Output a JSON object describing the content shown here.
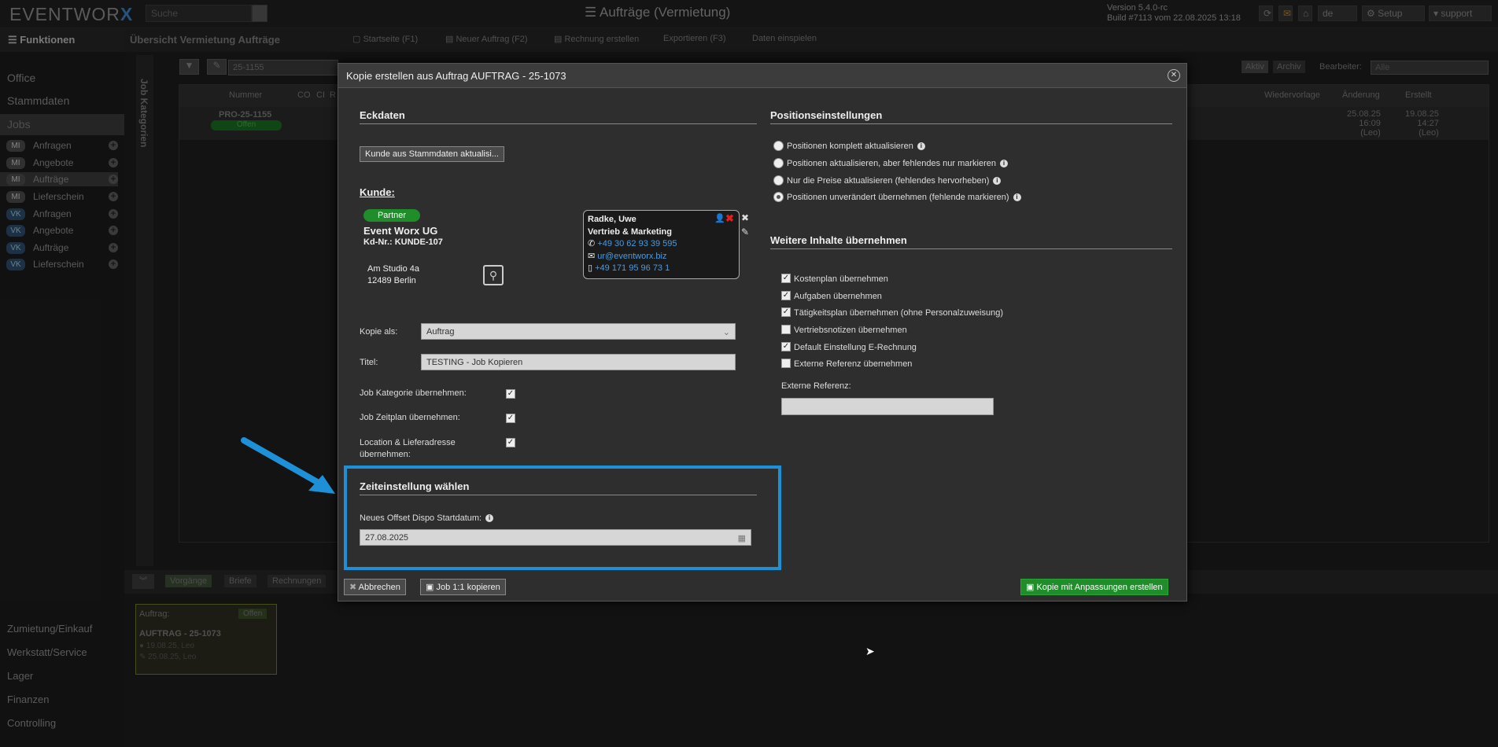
{
  "app": {
    "logo_text": "EVENTWOR",
    "logo_x": "X",
    "search_placeholder": "Suche",
    "title": "Aufträge (Vermietung)",
    "version_line1": "Version 5.4.0-rc",
    "version_line2": "Build #7113 vom 22.08.2025 13:18",
    "lang": "de",
    "setup": "Setup",
    "user": "support"
  },
  "sidebar": {
    "header": "Funktionen",
    "office": "Office",
    "stammdaten": "Stammdaten",
    "jobs": "Jobs",
    "items": [
      {
        "badge": "MI",
        "label": "Anfragen"
      },
      {
        "badge": "MI",
        "label": "Angebote"
      },
      {
        "badge": "MI",
        "label": "Aufträge"
      },
      {
        "badge": "MI",
        "label": "Lieferschein"
      },
      {
        "badge": "VK",
        "label": "Anfragen"
      },
      {
        "badge": "VK",
        "label": "Angebote"
      },
      {
        "badge": "VK",
        "label": "Aufträge"
      },
      {
        "badge": "VK",
        "label": "Lieferschein"
      }
    ],
    "bottom": [
      "Zumietung/Einkauf",
      "Werkstatt/Service",
      "Lager",
      "Finanzen",
      "Controlling"
    ]
  },
  "main": {
    "breadcrumb": "Übersicht Vermietung Aufträge",
    "toolbar": {
      "startseite": "Startseite",
      "startseite_key": "F1",
      "neuer_auftrag": "Neuer Auftrag",
      "neuer_auftrag_key": "F2",
      "rechnung": "Rechnung erstellen",
      "exportieren": "Exportieren",
      "exportieren_key": "F3",
      "daten": "Daten einspielen"
    },
    "filter_value": "25-1155",
    "job_kategorien": "Job Kategorien",
    "aktiv": "Aktiv",
    "archiv": "Archiv",
    "bearbeiter_label": "Bearbeiter:",
    "bearbeiter_value": "Alle",
    "columns": {
      "nummer": "Nummer",
      "co": "CO",
      "ci": "CI",
      "r": "R",
      "wiedervorlage": "Wiedervorlage",
      "aenderung": "Änderung",
      "erstellt": "Erstellt"
    },
    "row": {
      "nummer": "PRO-25-1155",
      "status": "Offen",
      "aenderung_date": "25.08.25",
      "aenderung_time": "16:09",
      "aenderung_user": "(Leo)",
      "erstellt_date": "19.08.25",
      "erstellt_time": "14:27",
      "erstellt_user": "(Leo)"
    },
    "bottom_tabs": [
      "Vorgänge",
      "Briefe",
      "Rechnungen"
    ],
    "card": {
      "label": "Auftrag:",
      "status": "Offen",
      "number": "AUFTRAG - 25-1073",
      "line1": "19.08.25, Leo",
      "line2": "25.08.25, Leo"
    }
  },
  "dialog": {
    "title": "Kopie erstellen aus Auftrag AUFTRAG - 25-1073",
    "eckdaten": "Eckdaten",
    "update_btn": "Kunde aus Stammdaten aktualisi...",
    "kunde_label": "Kunde:",
    "partner_badge": "Partner",
    "company": "Event Worx UG",
    "kd_nr": "Kd-Nr.: KUNDE-107",
    "street": "Am Studio 4a",
    "city": "12489 Berlin",
    "contact": {
      "name": "Radke, Uwe",
      "dept": "Vertrieb & Marketing",
      "phone": "+49 30 62 93 39 595",
      "email": "ur@eventworx.biz",
      "mobile": "+49 171 95 96 73 1"
    },
    "kopie_als_label": "Kopie als:",
    "kopie_als_value": "Auftrag",
    "titel_label": "Titel:",
    "titel_value": "TESTING - Job Kopieren",
    "job_kat_label": "Job Kategorie übernehmen:",
    "job_zeit_label": "Job Zeitplan übernehmen:",
    "location_label": "Location & Lieferadresse übernehmen:",
    "zeit_section": "Zeiteinstellung wählen",
    "offset_label": "Neues Offset Dispo Startdatum:",
    "offset_value": "27.08.2025",
    "pos_section": "Positionseinstellungen",
    "pos_options": [
      "Positionen komplett aktualisieren",
      "Positionen aktualisieren, aber fehlendes nur markieren",
      "Nur die Preise aktualisieren (fehlendes hervorheben)",
      "Positionen unverändert übernehmen (fehlende markieren)"
    ],
    "weitere_section": "Weitere Inhalte übernehmen",
    "weitere_options": [
      {
        "label": "Kostenplan übernehmen",
        "checked": true
      },
      {
        "label": "Aufgaben übernehmen",
        "checked": true
      },
      {
        "label": "Tätigkeitsplan übernehmen (ohne Personalzuweisung)",
        "checked": true
      },
      {
        "label": "Vertriebsnotizen übernehmen",
        "checked": false
      },
      {
        "label": "Default Einstellung E-Rechnung",
        "checked": true
      },
      {
        "label": "Externe Referenz übernehmen",
        "checked": false
      }
    ],
    "ext_ref_label": "Externe Referenz:",
    "cancel_btn": "Abbrechen",
    "copy11_btn": "Job 1:1 kopieren",
    "copy_adj_btn": "Kopie mit Anpassungen erstellen"
  },
  "colors": {
    "accent_green": "#1f8d2a",
    "highlight_blue": "#1e90d8",
    "partner_green": "#1f8d2a"
  }
}
